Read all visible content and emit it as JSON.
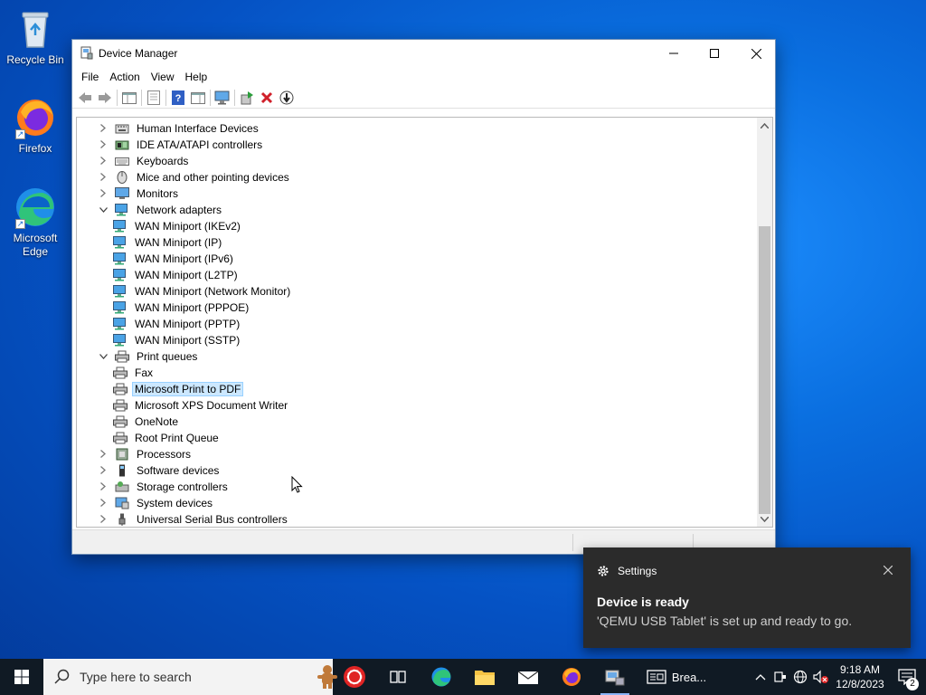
{
  "desktop": {
    "icons": [
      {
        "label": "Recycle Bin"
      },
      {
        "label": "Firefox"
      },
      {
        "label": "Microsoft Edge"
      }
    ]
  },
  "window": {
    "title": "Device Manager",
    "menu": [
      "File",
      "Action",
      "View",
      "Help"
    ],
    "tree": [
      {
        "label": "Human Interface Devices",
        "level": 0,
        "expand": "collapsed",
        "icon": "hid-icon"
      },
      {
        "label": "IDE ATA/ATAPI controllers",
        "level": 0,
        "expand": "collapsed",
        "icon": "ide-controller-icon"
      },
      {
        "label": "Keyboards",
        "level": 0,
        "expand": "collapsed",
        "icon": "keyboard-icon"
      },
      {
        "label": "Mice and other pointing devices",
        "level": 0,
        "expand": "collapsed",
        "icon": "mouse-icon"
      },
      {
        "label": "Monitors",
        "level": 0,
        "expand": "collapsed",
        "icon": "monitor-icon"
      },
      {
        "label": "Network adapters",
        "level": 0,
        "expand": "expanded",
        "icon": "network-adapter-icon"
      },
      {
        "label": "WAN Miniport (IKEv2)",
        "level": 1,
        "icon": "network-adapter-icon"
      },
      {
        "label": "WAN Miniport (IP)",
        "level": 1,
        "icon": "network-adapter-icon"
      },
      {
        "label": "WAN Miniport (IPv6)",
        "level": 1,
        "icon": "network-adapter-icon"
      },
      {
        "label": "WAN Miniport (L2TP)",
        "level": 1,
        "icon": "network-adapter-icon"
      },
      {
        "label": "WAN Miniport (Network Monitor)",
        "level": 1,
        "icon": "network-adapter-icon"
      },
      {
        "label": "WAN Miniport (PPPOE)",
        "level": 1,
        "icon": "network-adapter-icon"
      },
      {
        "label": "WAN Miniport (PPTP)",
        "level": 1,
        "icon": "network-adapter-icon"
      },
      {
        "label": "WAN Miniport (SSTP)",
        "level": 1,
        "icon": "network-adapter-icon"
      },
      {
        "label": "Print queues",
        "level": 0,
        "expand": "expanded",
        "icon": "printer-icon"
      },
      {
        "label": "Fax",
        "level": 1,
        "icon": "printer-icon"
      },
      {
        "label": "Microsoft Print to PDF",
        "level": 1,
        "icon": "printer-icon",
        "selected": true
      },
      {
        "label": "Microsoft XPS Document Writer",
        "level": 1,
        "icon": "printer-icon"
      },
      {
        "label": "OneNote",
        "level": 1,
        "icon": "printer-icon"
      },
      {
        "label": "Root Print Queue",
        "level": 1,
        "icon": "printer-icon"
      },
      {
        "label": "Processors",
        "level": 0,
        "expand": "collapsed",
        "icon": "processor-icon"
      },
      {
        "label": "Software devices",
        "level": 0,
        "expand": "collapsed",
        "icon": "software-device-icon"
      },
      {
        "label": "Storage controllers",
        "level": 0,
        "expand": "collapsed",
        "icon": "storage-controller-icon"
      },
      {
        "label": "System devices",
        "level": 0,
        "expand": "collapsed",
        "icon": "system-device-icon"
      },
      {
        "label": "Universal Serial Bus controllers",
        "level": 0,
        "expand": "collapsed",
        "icon": "usb-icon"
      }
    ]
  },
  "toast": {
    "app": "Settings",
    "title": "Device is ready",
    "body": "'QEMU USB Tablet' is set up and ready to go."
  },
  "taskbar": {
    "search_placeholder": "Type here to search",
    "running_app_label": "Brea...",
    "time": "9:18 AM",
    "date": "12/8/2023",
    "notification_count": "2"
  },
  "colors": {
    "desktop": "#0a6fe0",
    "selection": "#cce8ff",
    "toast_bg": "#2b2b2b",
    "taskbar": "#101a24"
  }
}
